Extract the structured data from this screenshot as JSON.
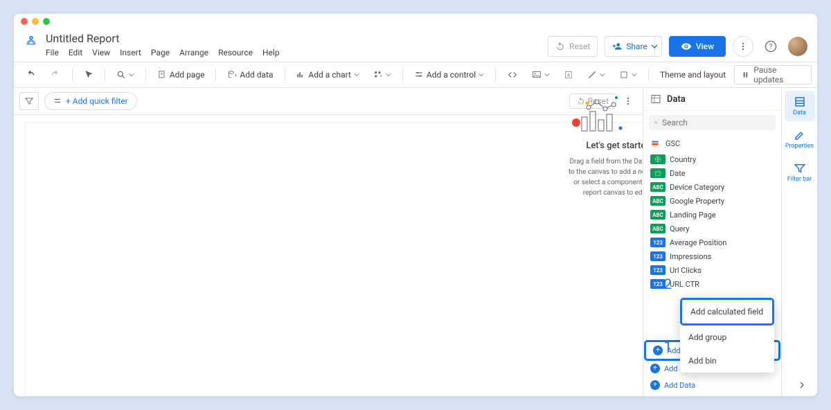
{
  "title": "Untitled Report",
  "menus": {
    "file": "File",
    "edit": "Edit",
    "view": "View",
    "insert": "Insert",
    "page": "Page",
    "arrange": "Arrange",
    "resource": "Resource",
    "help": "Help"
  },
  "header_buttons": {
    "reset": "Reset",
    "share": "Share",
    "view": "View"
  },
  "toolbar": {
    "add_page": "Add page",
    "add_data": "Add data",
    "add_chart": "Add a chart",
    "add_control": "Add a control",
    "theme": "Theme and layout",
    "pause": "Pause updates"
  },
  "filter": {
    "add_quick": "+ Add quick filter",
    "reset": "Reset"
  },
  "get_started": {
    "title": "Let's get started",
    "body": "Drag a field from the Data Panel to the canvas to add a new chart or select a component on the report canvas to edit it."
  },
  "side_tabs": {
    "data": "Data",
    "properties": "Properties",
    "filter_bar": "Filter bar"
  },
  "data_panel": {
    "title": "Data",
    "search_placeholder": "Search",
    "datasource": "GSC",
    "fields": {
      "country": "Country",
      "date": "Date",
      "device": "Device Category",
      "property": "Google Property",
      "landing": "Landing Page",
      "query": "Query",
      "avgpos": "Average Position",
      "impr": "Impressions",
      "clicks": "Url Clicks",
      "ctr": "URL CTR"
    },
    "add_field": "Add a field",
    "add_param": "Add a parameter",
    "add_data": "Add Data"
  },
  "popup": {
    "calc": "Add calculated field",
    "group": "Add group",
    "bin": "Add bin"
  },
  "callouts": {
    "one": "1",
    "two": "2"
  }
}
